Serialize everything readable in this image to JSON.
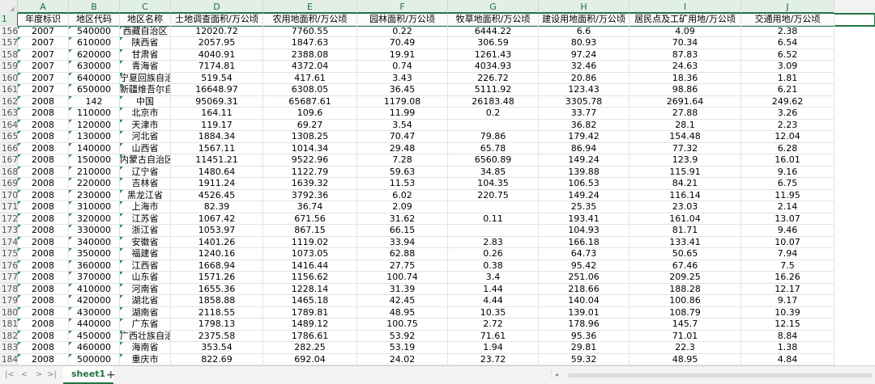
{
  "columns": [
    "A",
    "B",
    "C",
    "D",
    "E",
    "F",
    "G",
    "H",
    "I",
    "J"
  ],
  "header_row_number": "1",
  "headers": [
    "年度标识",
    "地区代码",
    "地区名称",
    "土地调查面积/万公顷",
    "农用地面积/万公顷",
    "园林面积/万公顷",
    "牧草地面积/万公顷",
    "建设用地面积/万公顷",
    "居民点及工矿用地/万公顷",
    "交通用地/万公顷"
  ],
  "rows": [
    [
      "156",
      "2007",
      "540000",
      "西藏自治区",
      "12020.72",
      "7760.55",
      "0.22",
      "6444.22",
      "6.6",
      "4.09",
      "2.38"
    ],
    [
      "157",
      "2007",
      "610000",
      "陕西省",
      "2057.95",
      "1847.63",
      "70.49",
      "306.59",
      "80.93",
      "70.34",
      "6.54"
    ],
    [
      "158",
      "2007",
      "620000",
      "甘肃省",
      "4040.91",
      "2388.08",
      "19.91",
      "1261.43",
      "97.24",
      "87.83",
      "6.52"
    ],
    [
      "159",
      "2007",
      "630000",
      "青海省",
      "7174.81",
      "4372.04",
      "0.74",
      "4034.93",
      "32.46",
      "24.63",
      "3.09"
    ],
    [
      "160",
      "2007",
      "640000",
      "宁夏回族自治区",
      "519.54",
      "417.61",
      "3.43",
      "226.72",
      "20.86",
      "18.36",
      "1.81"
    ],
    [
      "161",
      "2007",
      "650000",
      "新疆维吾尔自治区",
      "16648.97",
      "6308.05",
      "36.45",
      "5111.92",
      "123.43",
      "98.86",
      "6.21"
    ],
    [
      "162",
      "2008",
      "142",
      "中国",
      "95069.31",
      "65687.61",
      "1179.08",
      "26183.48",
      "3305.78",
      "2691.64",
      "249.62"
    ],
    [
      "163",
      "2008",
      "110000",
      "北京市",
      "164.11",
      "109.6",
      "11.99",
      "0.2",
      "33.77",
      "27.88",
      "3.26"
    ],
    [
      "164",
      "2008",
      "120000",
      "天津市",
      "119.17",
      "69.27",
      "3.54",
      "",
      "36.82",
      "28.1",
      "2.23"
    ],
    [
      "165",
      "2008",
      "130000",
      "河北省",
      "1884.34",
      "1308.25",
      "70.47",
      "79.86",
      "179.42",
      "154.48",
      "12.04"
    ],
    [
      "166",
      "2008",
      "140000",
      "山西省",
      "1567.11",
      "1014.34",
      "29.48",
      "65.78",
      "86.94",
      "77.32",
      "6.28"
    ],
    [
      "167",
      "2008",
      "150000",
      "内蒙古自治区",
      "11451.21",
      "9522.96",
      "7.28",
      "6560.89",
      "149.24",
      "123.9",
      "16.01"
    ],
    [
      "168",
      "2008",
      "210000",
      "辽宁省",
      "1480.64",
      "1122.79",
      "59.63",
      "34.85",
      "139.88",
      "115.91",
      "9.16"
    ],
    [
      "169",
      "2008",
      "220000",
      "吉林省",
      "1911.24",
      "1639.32",
      "11.53",
      "104.35",
      "106.53",
      "84.21",
      "6.75"
    ],
    [
      "170",
      "2008",
      "230000",
      "黑龙江省",
      "4526.45",
      "3792.36",
      "6.02",
      "220.75",
      "149.24",
      "116.14",
      "11.95"
    ],
    [
      "171",
      "2008",
      "310000",
      "上海市",
      "82.39",
      "36.74",
      "2.09",
      "",
      "25.35",
      "23.03",
      "2.14"
    ],
    [
      "172",
      "2008",
      "320000",
      "江苏省",
      "1067.42",
      "671.56",
      "31.62",
      "0.11",
      "193.41",
      "161.04",
      "13.07"
    ],
    [
      "173",
      "2008",
      "330000",
      "浙江省",
      "1053.97",
      "867.15",
      "66.15",
      "",
      "104.93",
      "81.71",
      "9.46"
    ],
    [
      "174",
      "2008",
      "340000",
      "安徽省",
      "1401.26",
      "1119.02",
      "33.94",
      "2.83",
      "166.18",
      "133.41",
      "10.07"
    ],
    [
      "175",
      "2008",
      "350000",
      "福建省",
      "1240.16",
      "1073.05",
      "62.88",
      "0.26",
      "64.73",
      "50.65",
      "7.94"
    ],
    [
      "176",
      "2008",
      "360000",
      "江西省",
      "1668.94",
      "1416.44",
      "27.75",
      "0.38",
      "95.42",
      "67.46",
      "7.5"
    ],
    [
      "177",
      "2008",
      "370000",
      "山东省",
      "1571.26",
      "1156.62",
      "100.74",
      "3.4",
      "251.06",
      "209.25",
      "16.26"
    ],
    [
      "178",
      "2008",
      "410000",
      "河南省",
      "1655.36",
      "1228.14",
      "31.39",
      "1.44",
      "218.66",
      "188.28",
      "12.17"
    ],
    [
      "179",
      "2008",
      "420000",
      "湖北省",
      "1858.88",
      "1465.18",
      "42.45",
      "4.44",
      "140.04",
      "100.86",
      "9.17"
    ],
    [
      "180",
      "2008",
      "430000",
      "湖南省",
      "2118.55",
      "1789.81",
      "48.95",
      "10.35",
      "139.01",
      "108.79",
      "10.39"
    ],
    [
      "181",
      "2008",
      "440000",
      "广东省",
      "1798.13",
      "1489.12",
      "100.75",
      "2.72",
      "178.96",
      "145.7",
      "12.15"
    ],
    [
      "182",
      "2008",
      "450000",
      "广西壮族自治区",
      "2375.58",
      "1786.61",
      "53.92",
      "71.61",
      "95.36",
      "71.01",
      "8.84"
    ],
    [
      "183",
      "2008",
      "460000",
      "海南省",
      "353.54",
      "282.25",
      "53.19",
      "1.94",
      "29.81",
      "22.3",
      "1.38"
    ],
    [
      "184",
      "2008",
      "500000",
      "重庆市",
      "822.69",
      "692.04",
      "24.02",
      "23.72",
      "59.32",
      "48.95",
      "4.84"
    ]
  ],
  "sheet_tab": "sheet1",
  "add_sheet": "+",
  "nav": [
    "|<",
    "<",
    ">",
    ">|"
  ],
  "accent_color": "#217346"
}
